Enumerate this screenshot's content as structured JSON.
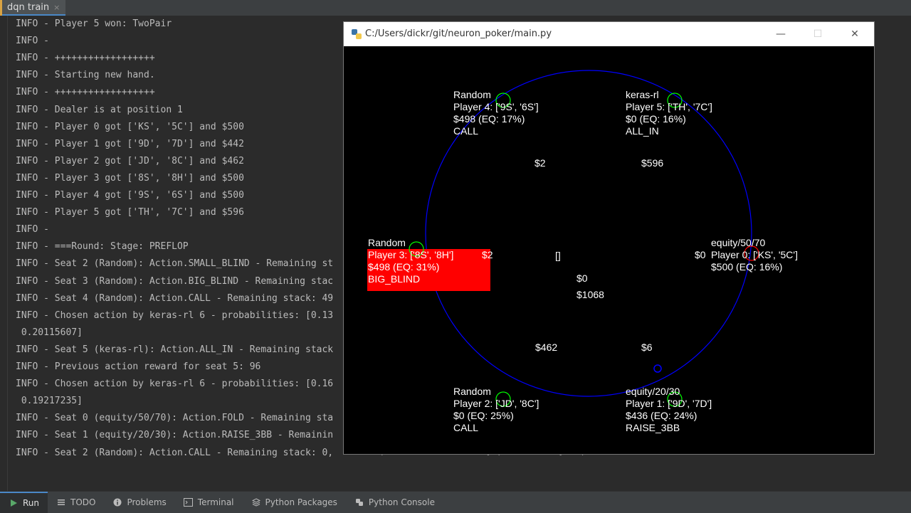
{
  "tab": {
    "label": "dqn train",
    "close": "×"
  },
  "log_lines": [
    "INFO - Player 5 won: TwoPair",
    "INFO -",
    "INFO - ++++++++++++++++++",
    "INFO - Starting new hand.",
    "INFO - ++++++++++++++++++",
    "INFO - Dealer is at position 1",
    "INFO - Player 0 got ['KS', '5C'] and $500",
    "INFO - Player 1 got ['9D', '7D'] and $442",
    "INFO - Player 2 got ['JD', '8C'] and $462",
    "INFO - Player 3 got ['8S', '8H'] and $500",
    "INFO - Player 4 got ['9S', '6S'] and $500",
    "INFO - Player 5 got ['TH', '7C'] and $596",
    "INFO -",
    "INFO - ===Round: Stage: PREFLOP",
    "INFO - Seat 2 (Random): Action.SMALL_BLIND - Remaining st",
    "INFO - Seat 3 (Random): Action.BIG_BLIND - Remaining stac",
    "INFO - Seat 4 (Random): Action.CALL - Remaining stack: 49",
    "INFO - Chosen action by keras-rl 6 - probabilities: [0.13",
    " 0.20115607]",
    "INFO - Seat 5 (keras-rl): Action.ALL_IN - Remaining stack",
    "INFO - Previous action reward for seat 5: 96",
    "INFO - Chosen action by keras-rl 6 - probabilities: [0.16",
    " 0.19217235]",
    "INFO - Seat 0 (equity/50/70): Action.FOLD - Remaining sta",
    "INFO - Seat 1 (equity/20/30): Action.RAISE_3BB - Remainin",
    "INFO - Seat 2 (Random): Action.CALL - Remaining stack: 0,"
  ],
  "log_tail": "Round pot: 1068, Community pot: 0, Player pot: 462",
  "window": {
    "title": "C:/Users/dickr/git/neuron_poker/main.py",
    "min": "—",
    "max": "☐",
    "close": "✕"
  },
  "table": {
    "players": [
      {
        "type": "Random",
        "cards": "Player 4: ['9S', '6S']",
        "stack": "$498 (EQ: 17%)",
        "action": "CALL",
        "bet": "$2",
        "highlight": false
      },
      {
        "type": "keras-rl",
        "cards": "Player 5: ['TH', '7C']",
        "stack": "$0 (EQ: 16%)",
        "action": "ALL_IN",
        "bet": "$596",
        "highlight": false
      },
      {
        "type": "equity/50/70",
        "cards": "Player 0: ['KS', '5C']",
        "stack": "$500 (EQ: 16%)",
        "action": "",
        "bet": "$0",
        "highlight": false
      },
      {
        "type": "equity/20/30",
        "cards": "Player 1: ['9D', '7D']",
        "stack": "$436 (EQ: 24%)",
        "action": "RAISE_3BB",
        "bet": "$6",
        "highlight": false
      },
      {
        "type": "Random",
        "cards": "Player 2: ['JD', '8C']",
        "stack": "$0 (EQ: 25%)",
        "action": "CALL",
        "bet": "$462",
        "highlight": false
      },
      {
        "type": "Random",
        "cards": "Player 3: ['8S', '8H']",
        "stack": "$498 (EQ: 31%)",
        "action": "BIG_BLIND",
        "bet": "$2",
        "highlight": true
      }
    ],
    "community_cards": "[]",
    "community_pot": "$0",
    "round_pot": "$1068",
    "table_color": "#0000ff",
    "highlight_color": "#ff0000",
    "marker_color": "#00ff00"
  },
  "statusbar": [
    {
      "label": "Run",
      "icon": "run-icon",
      "active": true
    },
    {
      "label": "TODO",
      "icon": "list-icon",
      "active": false
    },
    {
      "label": "Problems",
      "icon": "info-icon",
      "active": false
    },
    {
      "label": "Terminal",
      "icon": "terminal-icon",
      "active": false
    },
    {
      "label": "Python Packages",
      "icon": "layers-icon",
      "active": false
    },
    {
      "label": "Python Console",
      "icon": "python-icon",
      "active": false
    }
  ]
}
